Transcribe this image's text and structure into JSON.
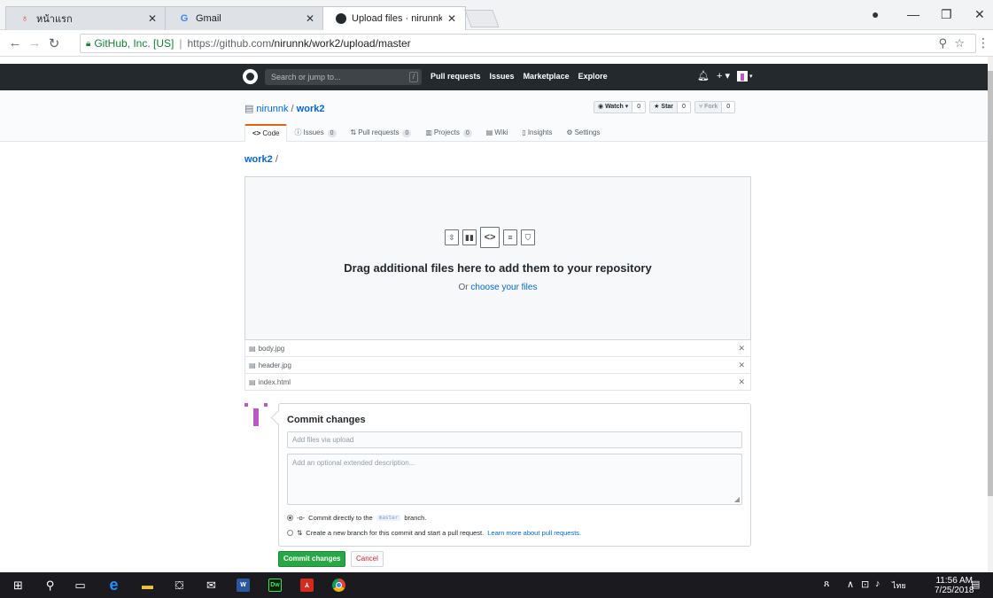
{
  "browser": {
    "tabs": [
      {
        "title": "หน้าแรก",
        "active": false
      },
      {
        "title": "Gmail",
        "active": false
      },
      {
        "title": "Upload files · nirunnk/wo",
        "active": true
      }
    ],
    "ev_label": "GitHub, Inc. [US]",
    "url_host": "https://github.com",
    "url_path": "/nirunnk/work2/upload/master"
  },
  "gh": {
    "search_placeholder": "Search or jump to...",
    "slash": "/",
    "nav": [
      "Pull requests",
      "Issues",
      "Marketplace",
      "Explore"
    ]
  },
  "repo": {
    "owner": "nirunnk",
    "name": "work2",
    "watch_label": "Watch ▾",
    "watch_count": "0",
    "star_label": "Star",
    "star_count": "0",
    "fork_label": "Fork",
    "fork_count": "0",
    "tabs": {
      "code": "Code",
      "issues": "Issues",
      "issues_count": "0",
      "pulls": "Pull requests",
      "pulls_count": "0",
      "projects": "Projects",
      "projects_count": "0",
      "wiki": "Wiki",
      "insights": "Insights",
      "settings": "Settings"
    }
  },
  "breadcrumb": {
    "repo": "work2",
    "sep": "/"
  },
  "dropzone": {
    "title": "Drag additional files here to add them to your repository",
    "or": "Or ",
    "choose": "choose your files"
  },
  "files": [
    "body.jpg",
    "header.jpg",
    "index.html"
  ],
  "commit": {
    "title": "Commit changes",
    "summary_placeholder": "Add files via upload",
    "desc_placeholder": "Add an optional extended description...",
    "opt1_pre": "Commit directly to the",
    "opt1_branch": "master",
    "opt1_post": "branch.",
    "opt2_text": "Create a new branch for this commit and start a pull request.",
    "opt2_link": "Learn more about pull requests.",
    "submit": "Commit changes",
    "cancel": "Cancel"
  },
  "taskbar": {
    "lang": "ไทย",
    "time": "11:56 AM",
    "date": "7/25/2018"
  }
}
